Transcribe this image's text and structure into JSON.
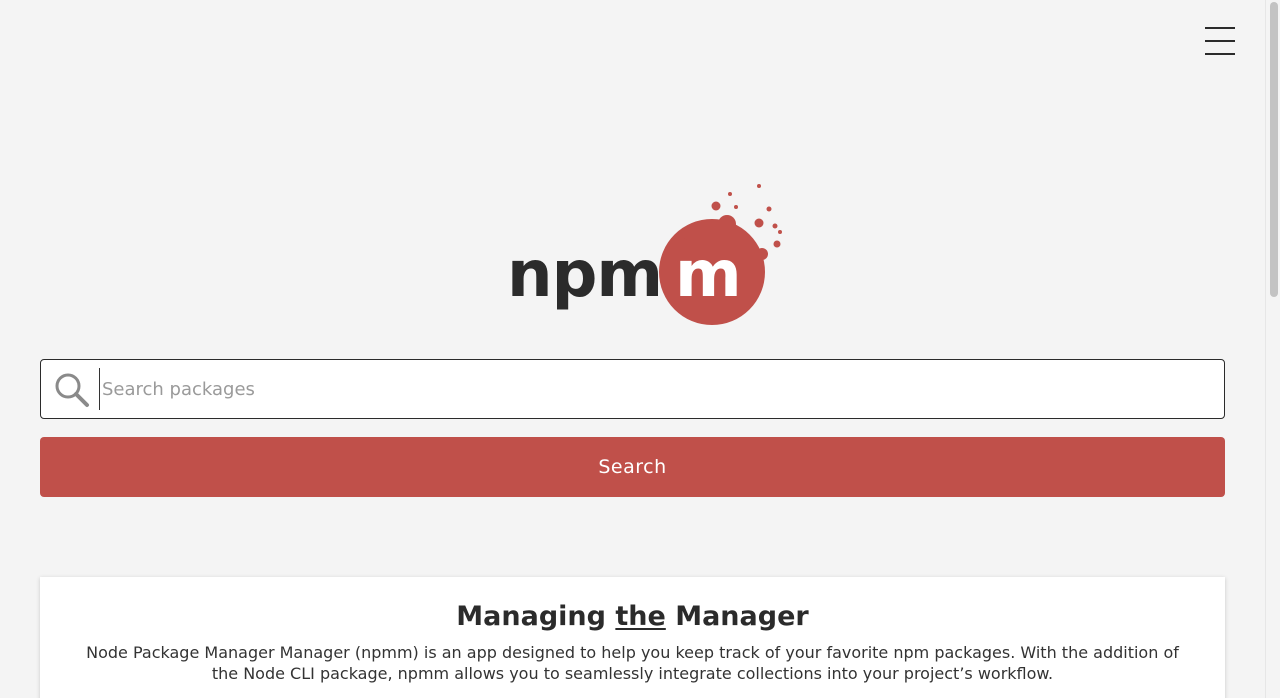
{
  "header": {
    "menu_icon": "hamburger-menu-icon"
  },
  "logo": {
    "text_dark": "npm",
    "text_light": "m",
    "accent_color": "#c0504a",
    "dark_color": "#2b2b2b"
  },
  "search": {
    "placeholder": "Search packages",
    "value": "",
    "icon": "search-icon",
    "button_label": "Search"
  },
  "about": {
    "title_before": "Managing ",
    "title_underlined": "the",
    "title_after": " Manager",
    "body": "Node Package Manager Manager (npmm) is an app designed to help you keep track of your favorite npm packages. With the addition of the Node CLI package, npmm allows you to seamlessly integrate collections into your project’s workflow."
  }
}
